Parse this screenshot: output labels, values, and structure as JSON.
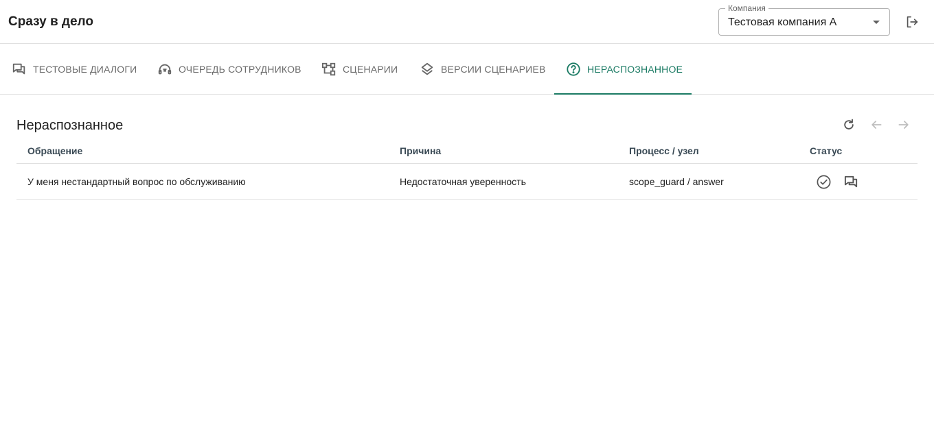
{
  "app": {
    "title": "Сразу в дело"
  },
  "company": {
    "label": "Компания",
    "value": "Тестовая компания А"
  },
  "header": {
    "logout_icon": "logout-icon"
  },
  "tabs": [
    {
      "label": "ТЕСТОВЫЕ ДИАЛОГИ",
      "icon": "chat-icon",
      "active": false
    },
    {
      "label": "ОЧЕРЕДЬ СОТРУДНИКОВ",
      "icon": "headset-icon",
      "active": false
    },
    {
      "label": "СЦЕНАРИИ",
      "icon": "flowchart-icon",
      "active": false
    },
    {
      "label": "ВЕРСИИ СЦЕНАРИЕВ",
      "icon": "layers-icon",
      "active": false
    },
    {
      "label": "НЕРАСПОЗНАННОЕ",
      "icon": "help-circle-icon",
      "active": true
    }
  ],
  "section": {
    "title": "Нераспознанное",
    "tools": [
      "refresh-icon",
      "arrow-left-icon",
      "arrow-right-icon"
    ]
  },
  "table": {
    "columns": [
      "Обращение",
      "Причина",
      "Процесс / узел",
      "Статус"
    ],
    "rows": [
      {
        "request": "У меня нестандартный вопрос по обслуживанию",
        "reason": "Недостаточная уверенность",
        "process": "scope_guard / answer",
        "status_icons": [
          "check-circle-icon",
          "chat-icon"
        ]
      }
    ]
  },
  "colors": {
    "accent": "#1a7a63",
    "tab_inactive": "#6b6b6b",
    "divider": "#e0e0e0",
    "header_text": "#3a4a55"
  }
}
